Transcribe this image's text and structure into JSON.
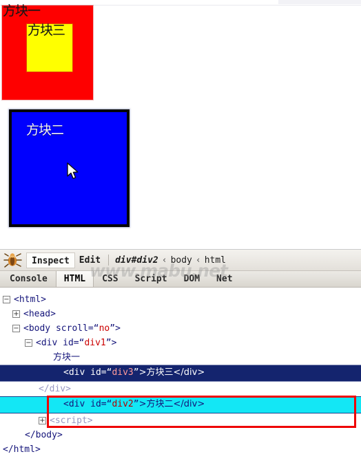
{
  "page_render": {
    "div1": {
      "id": "div1",
      "text": "方块一",
      "color": "#FF0000"
    },
    "div3": {
      "id": "div3",
      "text": "方块三",
      "color": "#FFFF00"
    },
    "div2": {
      "id": "div2",
      "text": "方块二",
      "color": "#0000FF",
      "border_color": "#000000"
    },
    "cursor": "mouse-pointer"
  },
  "firebug": {
    "logo_alt": "firebug-bug-logo",
    "toolbar": {
      "inspect_label": "Inspect",
      "edit_label": "Edit",
      "breadcrumb": [
        {
          "label": "div#div2",
          "selected": true
        },
        {
          "label": "body",
          "selected": false
        },
        {
          "label": "html",
          "selected": false
        }
      ],
      "breadcrumb_separator": "‹"
    },
    "tabs": [
      {
        "label": "Console",
        "active": false
      },
      {
        "label": "HTML",
        "active": true
      },
      {
        "label": "CSS",
        "active": false
      },
      {
        "label": "Script",
        "active": false
      },
      {
        "label": "DOM",
        "active": false
      },
      {
        "label": "Net",
        "active": false
      }
    ],
    "watermark": "www.mabu.net",
    "tree": {
      "r0": {
        "twisty": "−",
        "text": "<html>"
      },
      "r1": {
        "twisty": "+",
        "text": "<head>"
      },
      "r2": {
        "twisty": "−",
        "pre": "<body scroll=",
        "attr": "no",
        "post": ">"
      },
      "r3": {
        "twisty": "−",
        "pre": "<div id=",
        "attr": "div1",
        "post": ">"
      },
      "r4": {
        "text": "方块一"
      },
      "r5": {
        "pre": "<div id=",
        "attr": "div3",
        "post": ">方块三</div>",
        "highlight": "dark"
      },
      "r6": {
        "text": "</div>"
      },
      "r7": {
        "pre": "<div id=",
        "attr": "div2",
        "post": ">方块二</div>",
        "highlight": "cyan"
      },
      "r8": {
        "twisty": "+",
        "text": "<script>"
      },
      "r9": {
        "text": "</body>"
      },
      "r10": {
        "text": "</html>"
      }
    },
    "annotation": {
      "name": "red-highlight-box",
      "color": "#EE0000"
    }
  }
}
